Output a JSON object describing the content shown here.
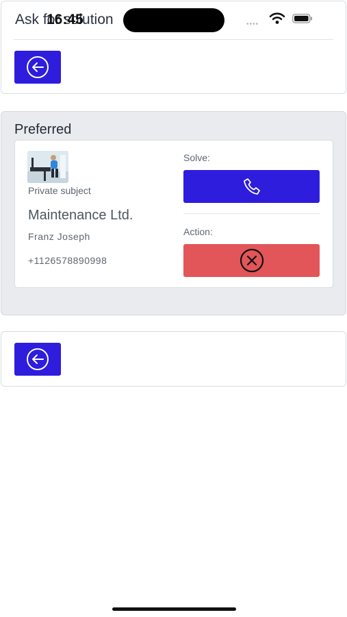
{
  "header": {
    "title": "Ask for solution",
    "time": "16:45",
    "dots": "••••"
  },
  "section": {
    "title": "Preferred"
  },
  "card": {
    "subject_label": "Private subject",
    "company": "Maintenance Ltd.",
    "contact_name": "Franz Joseph",
    "phone": "+1126578890998",
    "solve_label": "Solve:",
    "action_label": "Action:"
  },
  "icons": {
    "back": "arrow-left-circle-icon",
    "call": "phone-icon",
    "cancel": "x-circle-icon"
  },
  "colors": {
    "primary": "#2e1ddc",
    "danger": "#e25558",
    "section_bg": "#e9ebee"
  }
}
